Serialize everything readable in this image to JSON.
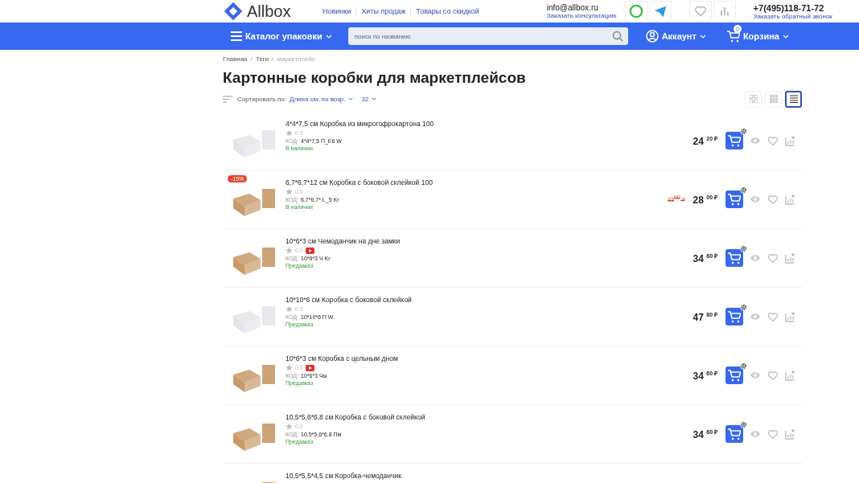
{
  "header": {
    "logo": "Allbox",
    "links": [
      "Новинки",
      "Хиты продаж",
      "Товары со скидкой"
    ],
    "email": "info@allbox.ru",
    "consult": "Заказать консультацию",
    "phone": "+7(495)118-71-72",
    "callback": "Заказать обратный звонок"
  },
  "navbar": {
    "catalog": "Каталог упаковки",
    "search": {
      "placeholder": "поиск по названию"
    },
    "account": "Аккаунт",
    "cart": "Корзина",
    "cart_count": "0"
  },
  "breadcrumbs": [
    {
      "label": "Главная",
      "current": false
    },
    {
      "separator": "/",
      "label": "Теги",
      "current": false
    },
    {
      "separator": "/",
      "label": "маркетплейс",
      "current": true
    }
  ],
  "title": "Картонные коробки для маркетплейсов",
  "sort": {
    "label": "Сортировать по:",
    "value": "Длина см. по возр.",
    "per_page": "32"
  },
  "views": [
    {
      "kind": "tiles",
      "selected": false
    },
    {
      "kind": "grid",
      "selected": false
    },
    {
      "kind": "list",
      "selected": true
    }
  ],
  "products": [
    {
      "kind": "white",
      "name": "4*4*7,5 см Коробка из микрогофрокартона 100",
      "rating": "0.0",
      "video": false,
      "code_label": "КОД:",
      "code": "4*4*7,5 П_Е6 W",
      "status": "В наличии",
      "price": "24",
      "cents": "20",
      "currency": "₽"
    },
    {
      "kind": "kraft",
      "badge": "-15%",
      "name": "6,7*6,7*12 см Коробка с боковой склейкой 100",
      "rating": "0.0",
      "video": false,
      "code_label": "КОД:",
      "code": "6,7*6,7* L_5 Kr",
      "status": "В наличии",
      "old_price": "33",
      "old_cents": "00",
      "old_currency": "₽",
      "price": "28",
      "cents": "00",
      "currency": "₽"
    },
    {
      "kind": "kraft",
      "name": "10*6*3 см Чемоданчик на дне замки",
      "rating": "0.0",
      "video": true,
      "code_label": "КОД:",
      "code": "10*6*3 Ч Kr",
      "status": "Предзаказ",
      "price": "34",
      "cents": "60",
      "currency": "₽"
    },
    {
      "kind": "white",
      "name": "10*10*6 см Коробка с боковой склейкой",
      "rating": "0.0",
      "video": false,
      "code_label": "КОД:",
      "code": "10*10*6 П W",
      "status": "Предзаказ",
      "price": "47",
      "cents": "80",
      "currency": "₽"
    },
    {
      "kind": "kraft",
      "name": "10*6*3 см Коробка с цельным дном",
      "rating": "0.0",
      "video": true,
      "code_label": "КОД:",
      "code": "10*6*3 Чы",
      "status": "Предзаказ",
      "price": "34",
      "cents": "60",
      "currency": "₽"
    },
    {
      "kind": "kraft",
      "name": "10,5*5,6*6,8 см Коробка с боковой склейкой",
      "rating": "0.0",
      "video": false,
      "code_label": "КОД:",
      "code": "10,5*5,6*6,8 Пм",
      "status": "Предзаказ",
      "price": "34",
      "cents": "60",
      "currency": "₽"
    },
    {
      "kind": "kraft",
      "name": "10,5*5,5*4,5 см Коробка-чемоданчик"
    }
  ]
}
